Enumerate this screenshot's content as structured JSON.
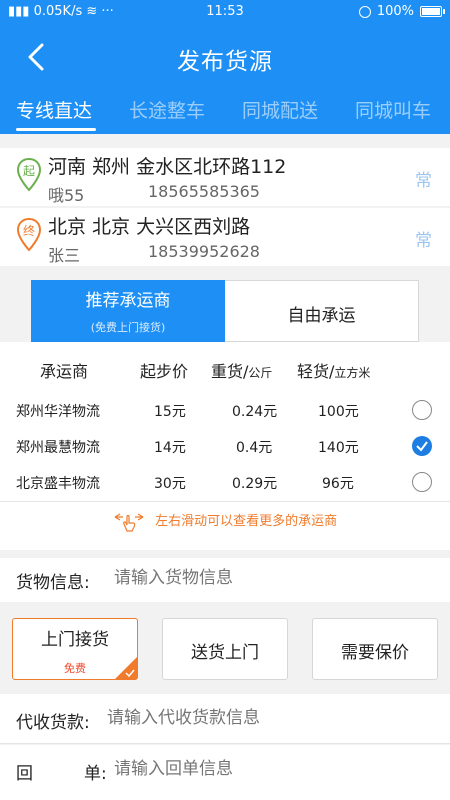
{
  "status": {
    "signal": "0.05K/s",
    "time": "11:53",
    "battery": "100%"
  },
  "header": {
    "title": "发布货源"
  },
  "tabs": [
    {
      "label": "专线直达"
    },
    {
      "label": "长途整车"
    },
    {
      "label": "同城配送"
    },
    {
      "label": "同城叫车"
    }
  ],
  "origin": {
    "badge": "起",
    "place": "河南 郑州 金水区北环路112",
    "person": "哦55",
    "phone": "18565585365",
    "often": "常"
  },
  "destination": {
    "badge": "终",
    "place": "北京 北京 大兴区西刘路",
    "person": "张三",
    "phone": "18539952628",
    "often": "常"
  },
  "segments": {
    "recommend": "推荐承运商",
    "recommend_sub": "(免费上门接货)",
    "free": "自由承运"
  },
  "carriers": {
    "headers": {
      "name": "承运商",
      "start": "起步价",
      "heavy": "重货/",
      "heavy_unit": "公斤",
      "light": "轻货/",
      "light_unit": "立方米"
    },
    "rows": [
      {
        "name": "郑州华洋物流",
        "start": "15元",
        "heavy": "0.24元",
        "light": "100元",
        "selected": false
      },
      {
        "name": "郑州最慧物流",
        "start": "14元",
        "heavy": "0.4元",
        "light": "140元",
        "selected": true
      },
      {
        "name": "北京盛丰物流",
        "start": "30元",
        "heavy": "0.29元",
        "light": "96元",
        "selected": false
      }
    ],
    "hint": "左右滑动可以查看更多的承运商"
  },
  "cargo": {
    "label": "货物信息:",
    "placeholder": "请输入货物信息"
  },
  "services": {
    "pickup": "上门接货",
    "pickup_sub": "免费",
    "delivery": "送货上门",
    "insurance": "需要保价"
  },
  "cod": {
    "label": "代收货款:",
    "placeholder": "请输入代收货款信息"
  },
  "receipt": {
    "label_a": "回",
    "label_b": "单:",
    "placeholder": "请输入回单信息"
  },
  "colors": {
    "primary": "#1e90f5",
    "accent": "#f07b2c",
    "origin_pin": "#6ab04c",
    "dest_pin": "#f07b2c"
  }
}
